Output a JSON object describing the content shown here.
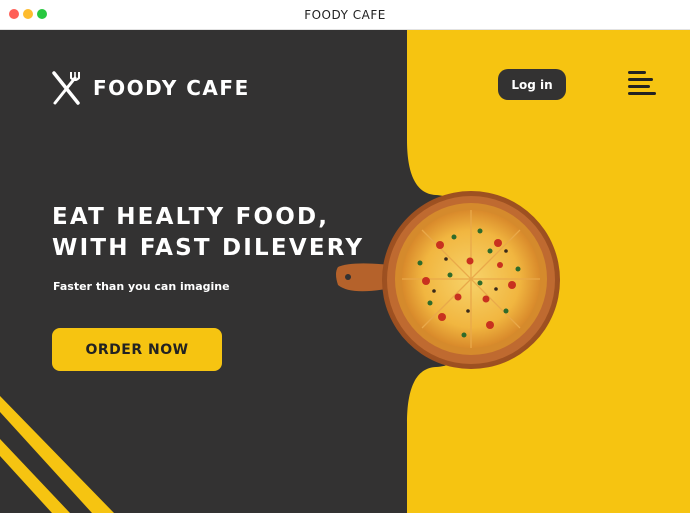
{
  "window": {
    "title": "FOODY CAFE"
  },
  "colors": {
    "background": "#333232",
    "accent": "#f6c411",
    "text": "#ffffff"
  },
  "brand": {
    "logo_icon": "fork-knife-icon",
    "name": "FOODY CAFE"
  },
  "nav": {
    "login_label": "Log in",
    "menu_icon": "hamburger-menu-icon"
  },
  "hero": {
    "headline_line1": "EAT HEALTY FOOD,",
    "headline_line2": "WITH FAST DILEVERY",
    "tagline": "Faster than you can imagine",
    "cta_label": "ORDER NOW",
    "image": "pizza-on-wooden-board"
  }
}
